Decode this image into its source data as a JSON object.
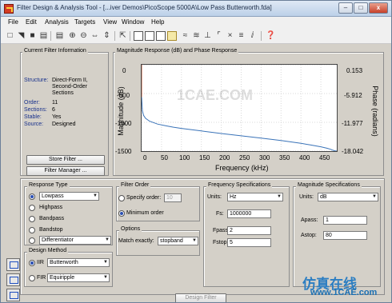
{
  "window": {
    "title": "Filter Design & Analysis Tool - [...iver Demos\\PicoScope 5000A\\Low Pass Butterworth.fda]",
    "min": "–",
    "max": "□",
    "close": "x"
  },
  "menu": [
    "File",
    "Edit",
    "Analysis",
    "Targets",
    "View",
    "Window",
    "Help"
  ],
  "current_filter": {
    "legend": "Current Filter Information",
    "rows": [
      {
        "label": "Structure:",
        "value": "Direct-Form II,"
      },
      {
        "label": "",
        "value": "Second-Order"
      },
      {
        "label": "",
        "value": "Sections"
      },
      {
        "label": "Order:",
        "value": "11"
      },
      {
        "label": "Sections:",
        "value": "6"
      },
      {
        "label": "Stable:",
        "value": "Yes"
      },
      {
        "label": "Source:",
        "value": "Designed"
      }
    ],
    "store_button": "Store Filter ...",
    "manager_button": "Filter Manager ..."
  },
  "plot": {
    "legend": "Magnitude Response (dB) and Phase Response"
  },
  "chart_data": {
    "type": "line",
    "title": "Magnitude Response (dB) and Phase Response",
    "xlabel": "Frequency (kHz)",
    "ylabel": "Magnitude (dB)",
    "y2label": "Phase (radians)",
    "xlim": [
      0,
      490
    ],
    "ylim": [
      -1500,
      0
    ],
    "x_ticks": [
      "0",
      "50",
      "100",
      "150",
      "200",
      "250",
      "300",
      "350",
      "400",
      "450"
    ],
    "y_ticks": [
      "0",
      "-500",
      "-1000",
      "-1500"
    ],
    "y2_ticks": [
      "0.153",
      "-5.912",
      "-11.977",
      "-18.042"
    ],
    "grid": true,
    "series": [
      {
        "color": "#3a73b8",
        "x": [
          0,
          2,
          5,
          10,
          20,
          40,
          60,
          80,
          100,
          150,
          200,
          250,
          300,
          350,
          400,
          425,
          450,
          465,
          475,
          480,
          485,
          490
        ],
        "y": [
          -560,
          -800,
          -880,
          -930,
          -980,
          -1030,
          -1060,
          -1085,
          -1105,
          -1150,
          -1195,
          -1235,
          -1275,
          -1315,
          -1365,
          -1395,
          -1425,
          -1450,
          -1470,
          -1485,
          -1495,
          -1500
        ]
      },
      {
        "color": "#d9542f",
        "x": [
          0,
          0
        ],
        "y": [
          0,
          -560
        ]
      }
    ]
  },
  "response_type": {
    "legend": "Response Type",
    "selected": "Lowpass",
    "options": [
      "Highpass",
      "Bandpass",
      "Bandstop"
    ],
    "extra": "Differentiator"
  },
  "design_method": {
    "legend": "Design Method",
    "iir_label": "IIR",
    "iir_value": "Butterworth",
    "fir_label": "FIR",
    "fir_value": "Equiripple"
  },
  "filter_order": {
    "legend": "Filter Order",
    "specify_label": "Specify order:",
    "specify_value": "10",
    "minimum_label": "Minimum order"
  },
  "options": {
    "legend": "Options",
    "match_label": "Match exactly:",
    "match_value": "stopband"
  },
  "frequency_specs": {
    "legend": "Frequency Specifications",
    "units_label": "Units:",
    "units_value": "Hz",
    "fs_label": "Fs:",
    "fs_value": "1000000",
    "fpass_label": "Fpass:",
    "fpass_value": "2",
    "fstop_label": "Fstop:",
    "fstop_value": "5"
  },
  "magnitude_specs": {
    "legend": "Magnitude Specifications",
    "units_label": "Units:",
    "units_value": "dB",
    "apass_label": "Apass:",
    "apass_value": "1",
    "astop_label": "Astop:",
    "astop_value": "80"
  },
  "design_button": "Design Filter",
  "overlay": {
    "watermark": "1CAE.COM",
    "brand_cn": "仿真在线",
    "brand_url": "www.1CAE.com"
  }
}
